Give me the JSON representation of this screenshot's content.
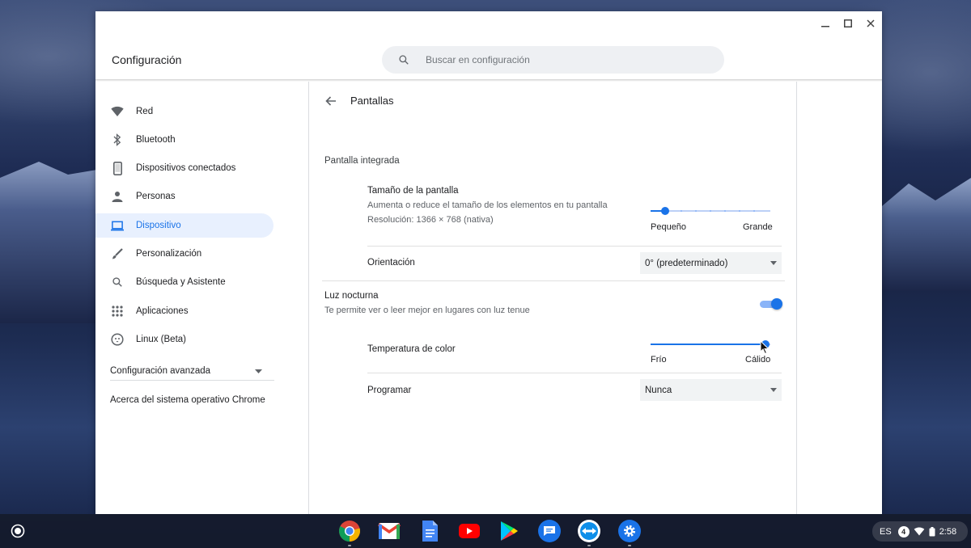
{
  "window": {
    "title": "Configuración",
    "controls": [
      "minimize",
      "maximize",
      "close"
    ]
  },
  "search": {
    "placeholder": "Buscar en configuración",
    "value": ""
  },
  "sidebar": {
    "items": [
      {
        "label": "Red",
        "icon": "wifi-icon"
      },
      {
        "label": "Bluetooth",
        "icon": "bluetooth-icon"
      },
      {
        "label": "Dispositivos conectados",
        "icon": "phone-icon"
      },
      {
        "label": "Personas",
        "icon": "person-icon"
      },
      {
        "label": "Dispositivo",
        "icon": "laptop-icon",
        "active": true
      },
      {
        "label": "Personalización",
        "icon": "brush-icon"
      },
      {
        "label": "Búsqueda y Asistente",
        "icon": "search-icon"
      },
      {
        "label": "Aplicaciones",
        "icon": "apps-grid-icon"
      },
      {
        "label": "Linux (Beta)",
        "icon": "linux-penguin-icon"
      }
    ],
    "advanced_label": "Configuración avanzada",
    "about_label": "Acerca del sistema operativo Chrome"
  },
  "main": {
    "page_title": "Pantallas",
    "section_title": "Pantalla integrada",
    "display_size": {
      "title": "Tamaño de la pantalla",
      "description": "Aumenta o reduce el tamaño de los elementos en tu pantalla",
      "resolution": "Resolución: 1366 × 768 (nativa)",
      "min_label": "Pequeño",
      "max_label": "Grande",
      "value_fraction": 0.12
    },
    "orientation": {
      "label": "Orientación",
      "value": "0° (predeterminado)"
    },
    "night_light": {
      "title": "Luz nocturna",
      "description": "Te permite ver o leer mejor en lugares con luz tenue",
      "enabled": true
    },
    "color_temperature": {
      "label": "Temperatura de color",
      "min_label": "Frío",
      "max_label": "Cálido",
      "value_fraction": 0.96
    },
    "schedule": {
      "label": "Programar",
      "value": "Nunca"
    }
  },
  "shelf": {
    "apps": [
      "chrome-icon",
      "gmail-icon",
      "docs-icon",
      "youtube-icon",
      "play-store-icon",
      "messages-icon",
      "teamviewer-icon",
      "settings-icon"
    ],
    "tray": {
      "ime": "ES",
      "notification_count": "4",
      "time": "2:58"
    }
  },
  "colors": {
    "accent": "#1a73e8",
    "active_bg": "#e8f0fe",
    "shelf": "#141a2a"
  }
}
